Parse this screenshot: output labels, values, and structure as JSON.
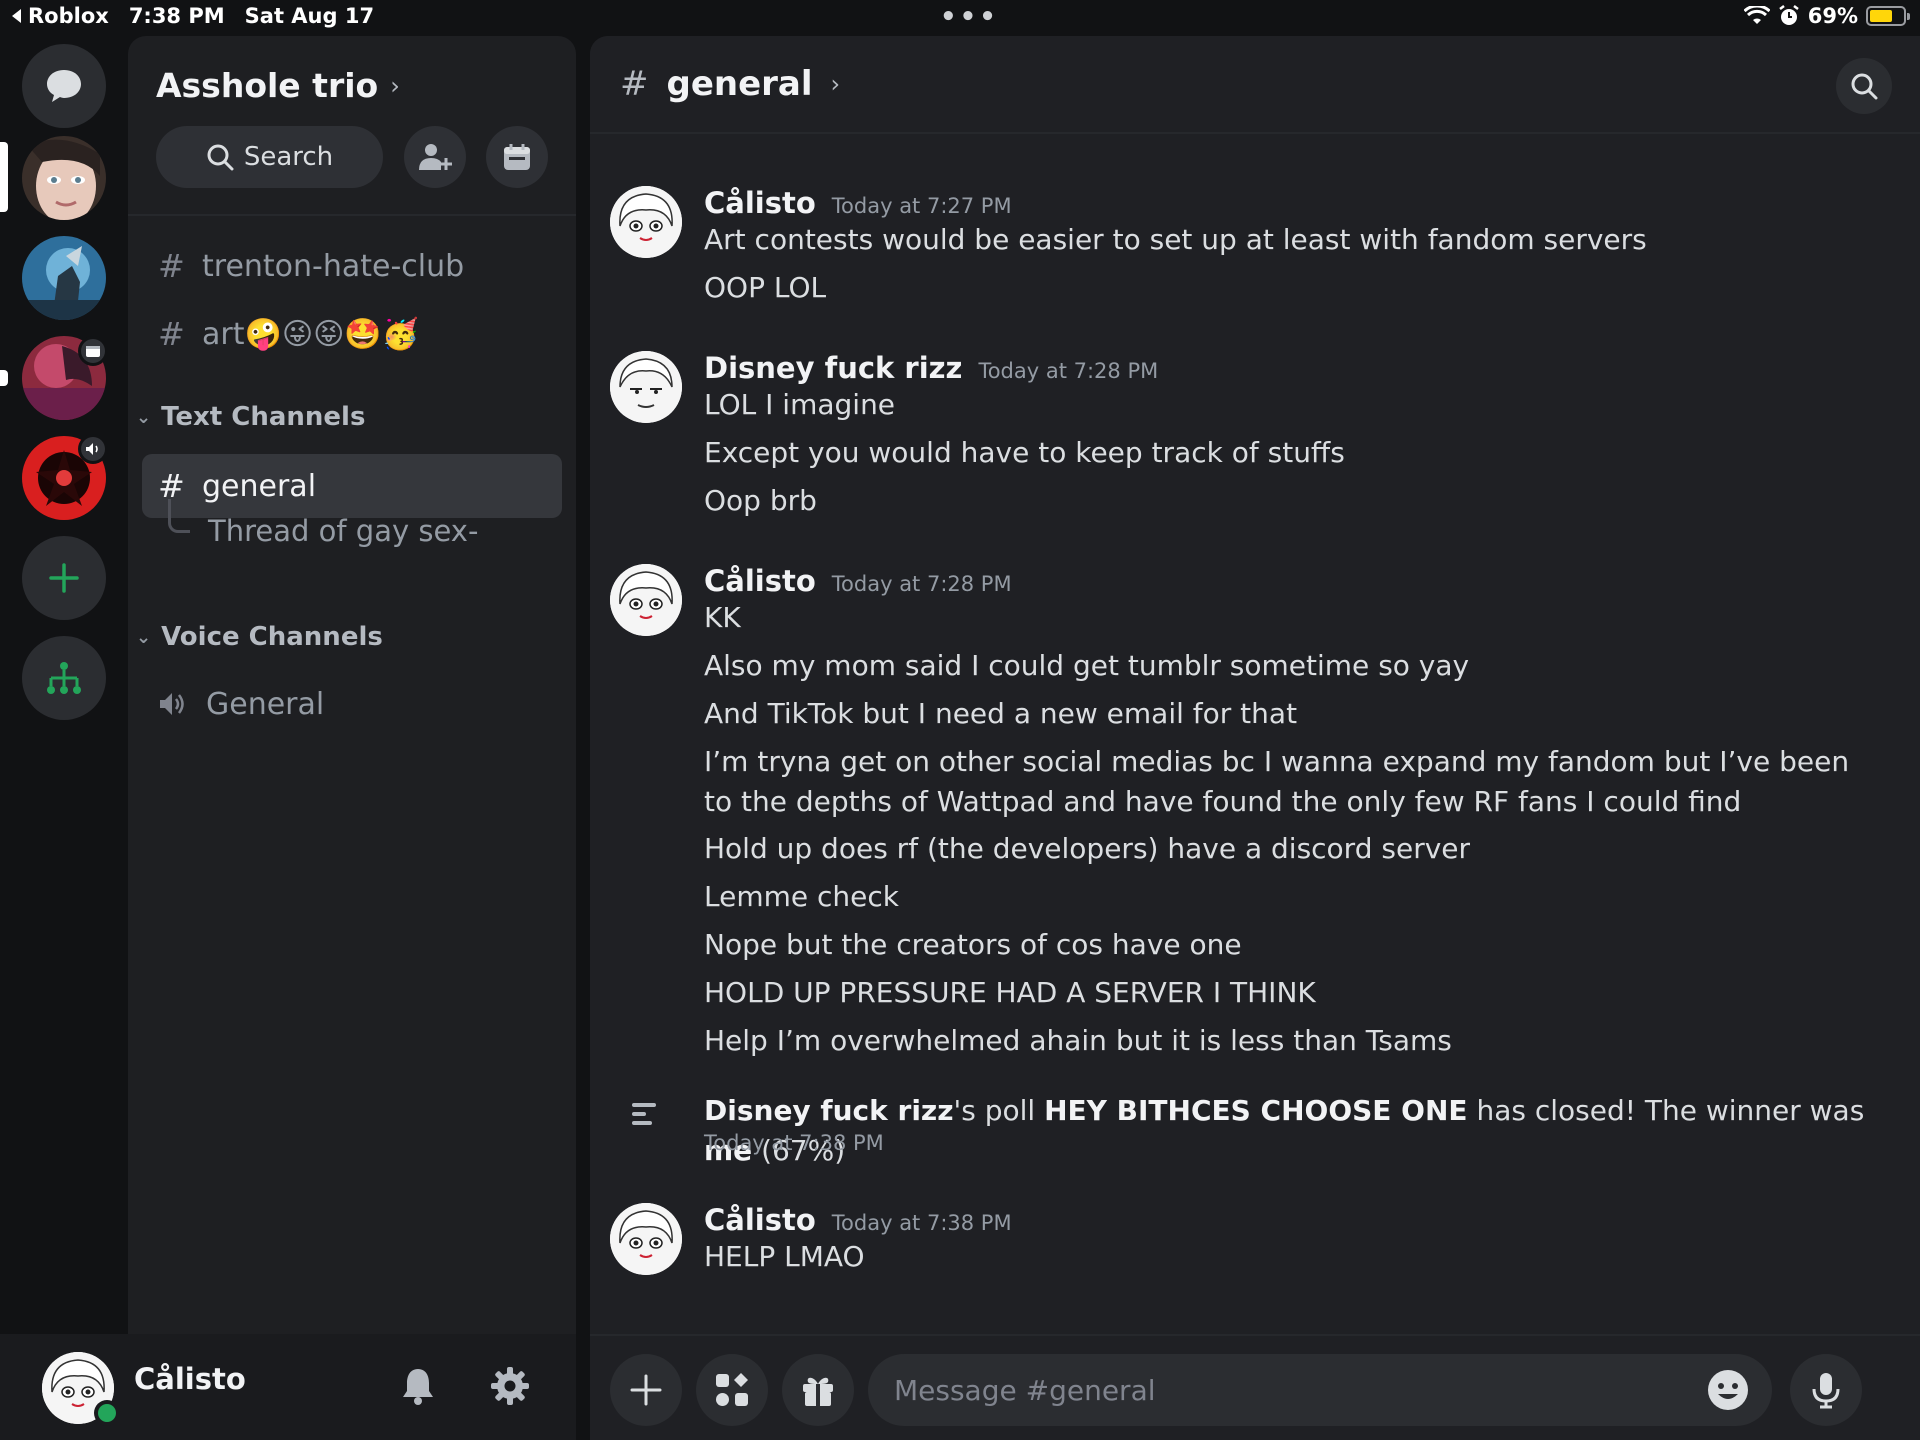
{
  "status_bar": {
    "back_app": "Roblox",
    "time": "7:38 PM",
    "date": "Sat Aug 17",
    "battery_text": "69%",
    "battery_level": 0.69
  },
  "server": {
    "name": "Asshole trio",
    "search_label": "Search"
  },
  "channels": {
    "uncategorized": [
      {
        "name": "trenton-hate-club"
      },
      {
        "name": "art🤪😜😝🤩🥳"
      }
    ],
    "text_category": "Text Channels",
    "text": [
      {
        "name": "general",
        "thread": "Thread of gay sex-"
      }
    ],
    "voice_category": "Voice Channels",
    "voice": [
      {
        "name": "General"
      }
    ]
  },
  "user_panel": {
    "username": "Cålisto"
  },
  "chat": {
    "channel": "general",
    "messages": [
      {
        "author": "Cålisto",
        "time": "Today at 7:27 PM",
        "lines": [
          "Art contests would be easier to set up at least with fandom servers",
          "OOP LOL"
        ]
      },
      {
        "author": "Disney fuck rizz",
        "time": "Today at 7:28 PM",
        "lines": [
          "LOL I imagine",
          "Except you would have to keep track of stuffs",
          "Oop brb"
        ]
      },
      {
        "author": "Cålisto",
        "time": "Today at 7:28 PM",
        "lines": [
          "KK",
          "Also my mom said I could get tumblr sometime so yay",
          "And TikTok but I need a new email for that",
          "I’m tryna get on other social medias bc I wanna expand my fandom but I’ve been to the depths of Wattpad and have found the only few RF fans I could find",
          "Hold up does rf (the developers) have a discord server",
          "Lemme check",
          "Nope but the creators of cos have one",
          "HOLD UP PRESSURE HAD A SERVER I THINK",
          "Help I’m overwhelmed ahain but it is less than Tsams"
        ]
      }
    ],
    "poll_notice": {
      "author": "Disney fuck rizz",
      "mid1": "'s poll ",
      "poll_name": "HEY BITHCES CHOOSE ONE",
      "mid2": " has closed! The winner was ",
      "winner": "me",
      "percent": " (67%)",
      "time": "Today at 7:38 PM"
    },
    "last_message": {
      "author": "Cålisto",
      "time": "Today at 7:38 PM",
      "lines": [
        "HELP LMAO"
      ]
    }
  },
  "composer": {
    "placeholder": "Message #general"
  }
}
